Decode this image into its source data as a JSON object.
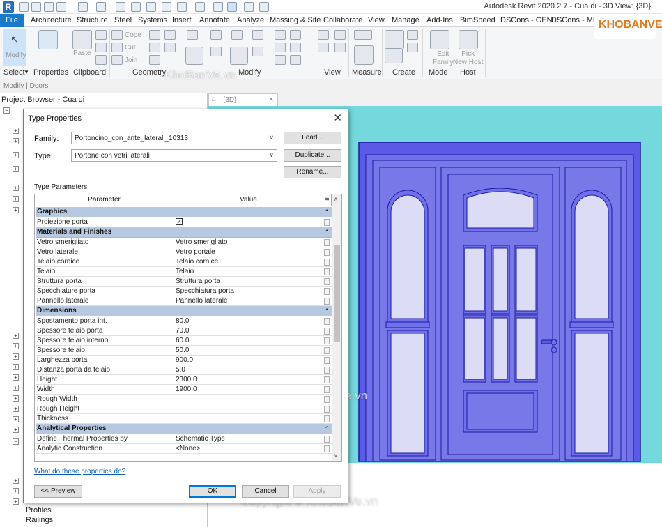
{
  "titlebar": {
    "title": "Autodesk Revit 2020.2.7 - Cua di - 3D View: {3D}"
  },
  "menu": {
    "file": "File",
    "tabs": [
      "Architecture",
      "Structure",
      "Steel",
      "Systems",
      "Insert",
      "Annotate",
      "Analyze",
      "Massing & Site",
      "Collaborate",
      "View",
      "Manage",
      "Add-Ins",
      "BimSpeed",
      "DSCons - GEN",
      "DSCons - MEP"
    ]
  },
  "ribbon": {
    "modify_label": "Modify",
    "select_label": "Select",
    "properties_label": "Properties",
    "clipboard_label": "Clipboard",
    "paste_label": "Paste",
    "cope_label": "Cope",
    "cut_label": "Cut",
    "join_label": "Join",
    "geometry_label": "Geometry",
    "modify_panel_label": "Modify",
    "view_label": "View",
    "measure_label": "Measure",
    "create_label": "Create",
    "edit_family_label": "Edit\nFamily",
    "pick_host_label": "Pick\nNew Host",
    "mode_label": "Mode",
    "host_label": "Host"
  },
  "options_bar": {
    "text": "Modify | Doors"
  },
  "browser": {
    "title": "Project Browser - Cua di",
    "items": [
      {
        "label": "Profiles"
      },
      {
        "label": "Railings"
      }
    ]
  },
  "view_tab": {
    "label": "{3D}"
  },
  "dialog": {
    "title": "Type Properties",
    "family_label": "Family:",
    "family_value": "Portoncino_con_ante_laterali_10313",
    "type_label": "Type:",
    "type_value": "Portone con vetri laterali",
    "load_button": "Load...",
    "duplicate_button": "Duplicate...",
    "rename_button": "Rename...",
    "type_parameters_label": "Type Parameters",
    "col_parameter": "Parameter",
    "col_value": "Value",
    "col_eq": "=",
    "help_link": "What do these properties do?",
    "preview_button": "<< Preview",
    "ok_button": "OK",
    "cancel_button": "Cancel",
    "apply_button": "Apply",
    "groups": [
      {
        "name": "Graphics",
        "rows": [
          {
            "p": "Proiezione porta",
            "v": "",
            "check": true
          }
        ]
      },
      {
        "name": "Materials and Finishes",
        "rows": [
          {
            "p": "Vetro smerigliato",
            "v": "Vetro smerigliato"
          },
          {
            "p": "Vetro laterale",
            "v": "Vetro portale"
          },
          {
            "p": "Telaio cornice",
            "v": "Telaio cornice"
          },
          {
            "p": "Telaio",
            "v": "Telaio"
          },
          {
            "p": "Struttura porta",
            "v": "Struttura porta"
          },
          {
            "p": "Specchiature porta",
            "v": "Specchiatura porta"
          },
          {
            "p": "Pannello laterale",
            "v": "Pannello laterale"
          }
        ]
      },
      {
        "name": "Dimensions",
        "rows": [
          {
            "p": "Spostamento porta int.",
            "v": "80.0"
          },
          {
            "p": "Spessore telaio porta",
            "v": "70.0"
          },
          {
            "p": "Spessore telaio interno",
            "v": "60.0"
          },
          {
            "p": "Spessore telaio",
            "v": "50.0"
          },
          {
            "p": "Larghezza porta",
            "v": "900.0"
          },
          {
            "p": "Distanza porta da telaio",
            "v": "5.0"
          },
          {
            "p": "Height",
            "v": "2300.0"
          },
          {
            "p": "Width",
            "v": "1900.0"
          },
          {
            "p": "Rough Width",
            "v": ""
          },
          {
            "p": "Rough Height",
            "v": ""
          },
          {
            "p": "Thickness",
            "v": ""
          }
        ]
      },
      {
        "name": "Analytical Properties",
        "rows": [
          {
            "p": "Define Thermal Properties by",
            "v": "Schematic Type"
          },
          {
            "p": "Analytic Construction",
            "v": "<None>"
          }
        ]
      }
    ]
  },
  "watermarks": {
    "brand": "KHOBANVE",
    "w1": "KhoBanVe.vn",
    "w2": "KhoBanVe.vn",
    "w3": "Copyright © KhoBanVe.vn"
  },
  "colors": {
    "door_fill": "#7878e8",
    "door_stroke": "#1a1aa0",
    "glass": "#dcdcf4",
    "sky": "#74d8dc"
  }
}
